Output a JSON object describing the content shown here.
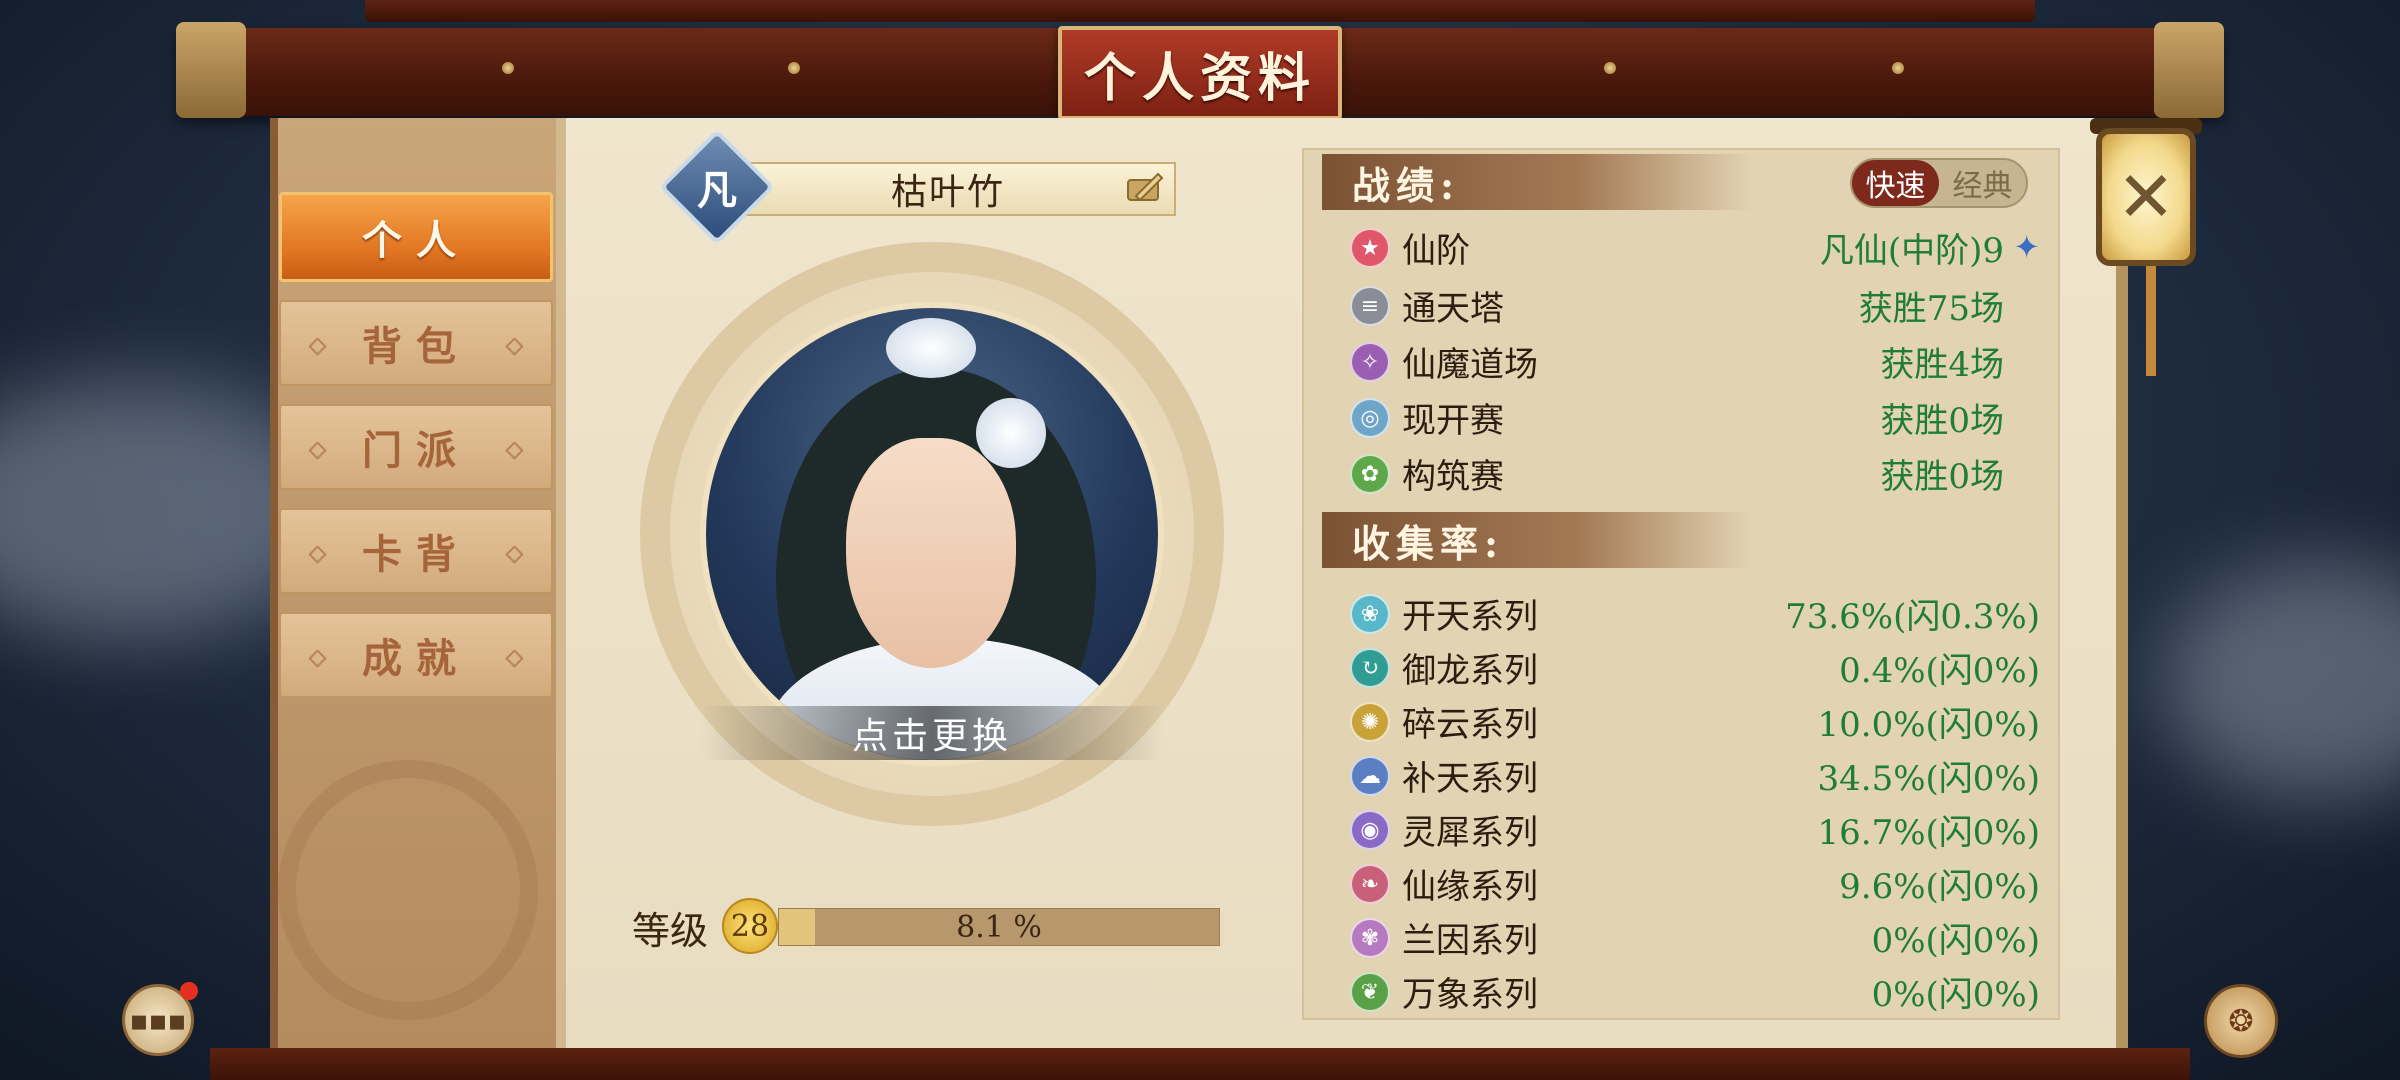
{
  "window": {
    "title": "个人资料"
  },
  "sidebar": {
    "items": [
      {
        "label": "个人",
        "active": true
      },
      {
        "label": "背包",
        "active": false
      },
      {
        "label": "门派",
        "active": false
      },
      {
        "label": "卡背",
        "active": false
      },
      {
        "label": "成就",
        "active": false
      }
    ]
  },
  "profile": {
    "rank_glyph": "凡",
    "name": "枯叶竹",
    "change_label": "点击更换",
    "level_label": "等级",
    "level": "28",
    "progress_text": "8.1 %",
    "progress_fraction": 0.081
  },
  "record": {
    "heading": "战绩:",
    "mode_toggle": {
      "active": "快速",
      "inactive": "经典"
    },
    "rows": [
      {
        "icon": "star-icon",
        "icon_color": "#e0566a",
        "label": "仙阶",
        "value": "凡仙(中阶)9"
      },
      {
        "icon": "tower-icon",
        "icon_color": "#8a8d96",
        "label": "通天塔",
        "value": "获胜75场"
      },
      {
        "icon": "demon-icon",
        "icon_color": "#9a5fb3",
        "label": "仙魔道场",
        "value": "获胜4场"
      },
      {
        "icon": "arena-icon",
        "icon_color": "#6fa5c9",
        "label": "现开赛",
        "value": "获胜0场"
      },
      {
        "icon": "build-icon",
        "icon_color": "#5fa84a",
        "label": "构筑赛",
        "value": "获胜0场"
      }
    ]
  },
  "collection": {
    "heading": "收集率:",
    "rows": [
      {
        "icon": "kaitian-icon",
        "icon_color": "#58b7c9",
        "label": "开天系列",
        "value": "73.6%(闪0.3%)"
      },
      {
        "icon": "yulong-icon",
        "icon_color": "#2f9d93",
        "label": "御龙系列",
        "value": "0.4%(闪0%)"
      },
      {
        "icon": "suiyun-icon",
        "icon_color": "#c9a23a",
        "label": "碎云系列",
        "value": "10.0%(闪0%)"
      },
      {
        "icon": "butian-icon",
        "icon_color": "#5c7fc4",
        "label": "补天系列",
        "value": "34.5%(闪0%)"
      },
      {
        "icon": "lingxi-icon",
        "icon_color": "#8a6ac6",
        "label": "灵犀系列",
        "value": "16.7%(闪0%)"
      },
      {
        "icon": "xianyuan-icon",
        "icon_color": "#c9607a",
        "label": "仙缘系列",
        "value": "9.6%(闪0%)"
      },
      {
        "icon": "lanyin-icon",
        "icon_color": "#b57ac0",
        "label": "兰因系列",
        "value": "0%(闪0%)"
      },
      {
        "icon": "wanxiang-icon",
        "icon_color": "#5aa046",
        "label": "万象系列",
        "value": "0%(闪0%)"
      }
    ]
  },
  "colors": {
    "value_green": "#1f7d35",
    "active_tab": "#e07320",
    "beam": "#4a180c"
  }
}
